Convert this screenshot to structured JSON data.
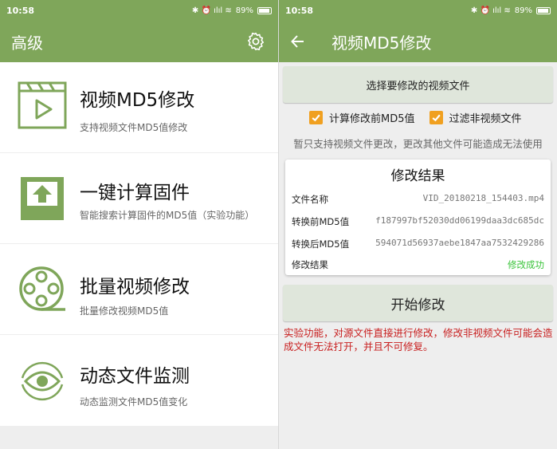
{
  "left": {
    "status": {
      "time": "10:58",
      "icons": "✱ ⏰ ılıl ≋",
      "battery": "89%"
    },
    "appbar": {
      "title": "高级"
    },
    "menu": [
      {
        "title": "视频MD5修改",
        "subtitle": "支持视频文件MD5值修改",
        "icon": "video-play-icon"
      },
      {
        "title": "一键计算固件",
        "subtitle": "智能搜索计算固件的MD5值（实验功能）",
        "icon": "upload-box-icon"
      },
      {
        "title": "批量视频修改",
        "subtitle": "批量修改视频MD5值",
        "icon": "film-reel-icon"
      },
      {
        "title": "动态文件监测",
        "subtitle": "动态监测文件MD5值变化",
        "icon": "eye-icon"
      }
    ]
  },
  "right": {
    "status": {
      "time": "10:58",
      "icons": "✱ ⏰ ılıl ≋",
      "battery": "89%"
    },
    "appbar": {
      "title": "视频MD5修改"
    },
    "choose_button": "选择要修改的视频文件",
    "checkbox_1": {
      "label": "计算修改前MD5值",
      "checked": true
    },
    "checkbox_2": {
      "label": "过滤非视频文件",
      "checked": true
    },
    "note": "暂只支持视频文件更改，更改其他文件可能造成无法使用",
    "result": {
      "title": "修改结果",
      "rows": [
        {
          "label": "文件名称",
          "value": "VID_20180218_154403.mp4"
        },
        {
          "label": "转换前MD5值",
          "value": "f187997bf52030dd06199daa3dc685dc"
        },
        {
          "label": "转换后MD5值",
          "value": "594071d56937aebe1847aa7532429286"
        },
        {
          "label": "修改结果",
          "value": "修改成功"
        }
      ]
    },
    "start_button": "开始修改",
    "warning": "实验功能，对源文件直接进行修改，修改非视频文件可能会造成文件无法打开，并且不可修复。"
  },
  "colors": {
    "appbar": "#7fa65a",
    "icon_green": "#7fa65a",
    "checkbox": "#f0a020",
    "warning": "#c81e1e",
    "success": "#3bc43b"
  }
}
